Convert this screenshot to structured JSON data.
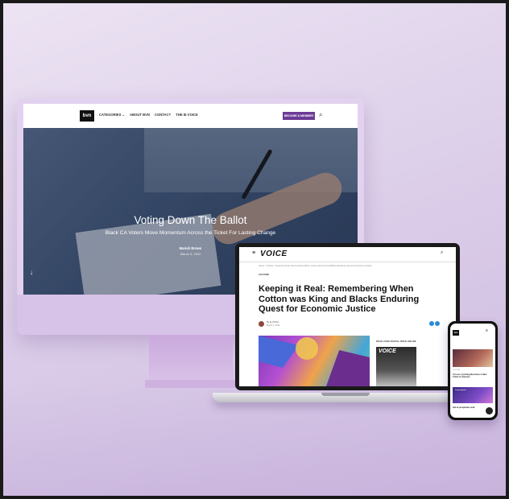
{
  "desktop_site": {
    "logo": "bvn",
    "nav_links": [
      "CATEGORIES ⌄",
      "ABOUT BVN",
      "CONTACT",
      "THE IE VOICE"
    ],
    "cta_label": "BECOME A MEMBER",
    "search_glyph": "⌕",
    "hero": {
      "title": "Voting Down The Ballot",
      "subtitle": "Black CA Voters Move Momentum Across the Ticket For Lasting Change",
      "author": "Mariah Brown",
      "date": "March 3, 2022",
      "scroll_glyph": "↓"
    }
  },
  "laptop_site": {
    "menu_glyph": "≡",
    "logo": "VOICE",
    "search_glyph": "⌕",
    "breadcrumb": "Home > Culture > Keeping it Real: Remembering When Cotton was King and Blacks Enduring Quest for Economic Justice",
    "category": "CULTURE",
    "headline": "Keeping it Real: Remembering When Cotton was King and Blacks Enduring Quest for Economic Justice",
    "author": "By IE VOICE",
    "author_date": "March 3, 2022",
    "sidebar_title": "READ VOICE DIGITAL ISSUE ONLINE",
    "sidebar_mag_word": "VOICE"
  },
  "phone_site": {
    "logo": "bvn",
    "menu_glyph": "≡",
    "category": "CULTURE",
    "title": "At Last, Lynching Becomes a Hate Crime in America",
    "image2_title": "Lorem ipsum",
    "title2": "Sed ut perspiciatis unde"
  },
  "icons": {
    "search": "search-icon",
    "menu": "hamburger-menu-icon",
    "scroll": "arrow-down-icon",
    "share": "share-icon"
  },
  "colors": {
    "background": "#ddd0ea",
    "cta": "#6b3b96",
    "share": "#2a8ad6"
  }
}
